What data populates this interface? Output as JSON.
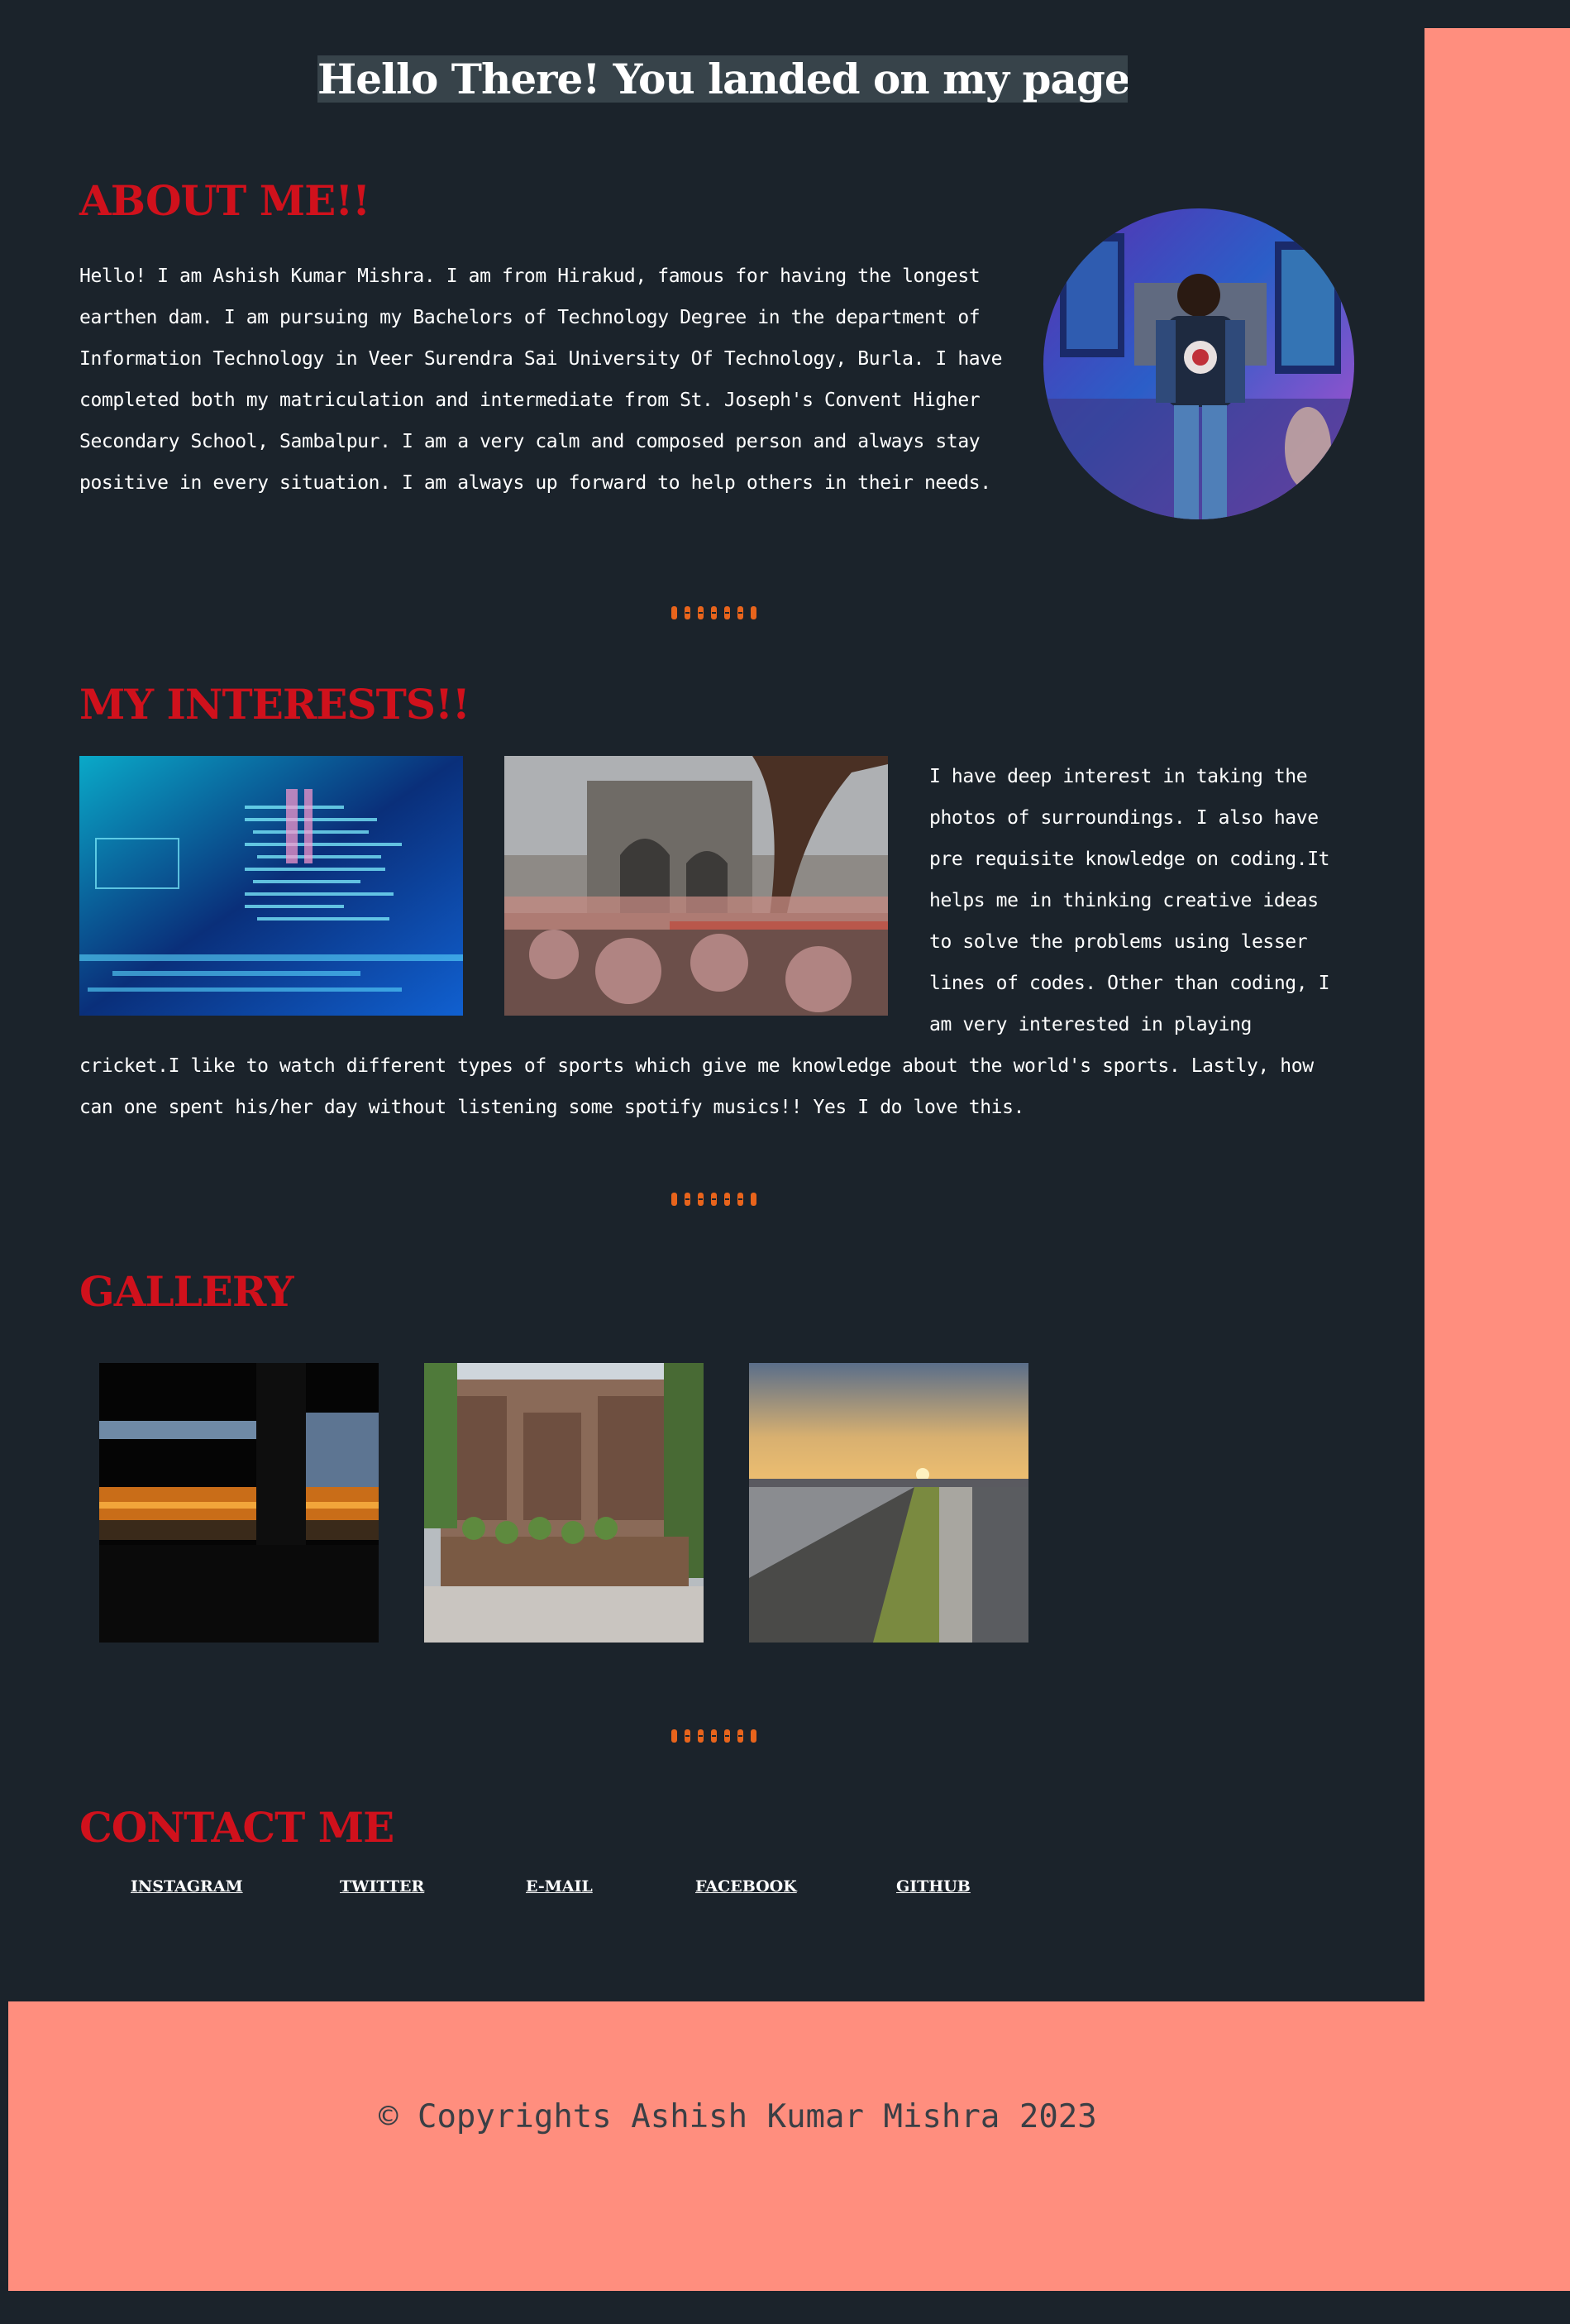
{
  "hero": {
    "title": "Hello There! You landed on my page."
  },
  "about": {
    "heading": "ABOUT ME!!",
    "text": "Hello! I am Ashish Kumar Mishra. I am from Hirakud, famous for having the longest earthen dam. I am pursuing my Bachelors of Technology Degree in the department of Information Technology in Veer Surendra Sai University Of Technology, Burla. I have completed both my matriculation and intermediate from St. Joseph's Convent Higher Secondary School, Sambalpur. I am a very calm and composed person and always stay positive in every situation. I am always up forward to help others in their needs."
  },
  "interests": {
    "heading": "MY INTERESTS!!",
    "text": "I have deep interest in taking the photos of surroundings. I also have pre requisite knowledge on coding.It helps me in thinking creative ideas to solve the problems using lesser lines of codes. Other than coding, I am very interested in playing cricket.I like to watch different types of sports which give me knowledge about the world's sports. Lastly, how can one spent his/her day without listening some spotify musics!! Yes I do love this."
  },
  "gallery": {
    "heading": "GALLERY"
  },
  "contact": {
    "heading": "CONTACT ME",
    "links": [
      "INSTAGRAM",
      "TWITTER",
      "E-MAIL",
      "FACEBOOK",
      "GITHUB"
    ]
  },
  "footer": {
    "text": "© Copyrights Ashish Kumar Mishra 2023"
  },
  "colors": {
    "background": "#1b232b",
    "accent_salmon": "#ff8e7e",
    "heading_red": "#d0111c",
    "divider_orange": "#e8641c"
  },
  "icons": {
    "divider": "ornamental-dots-divider"
  }
}
